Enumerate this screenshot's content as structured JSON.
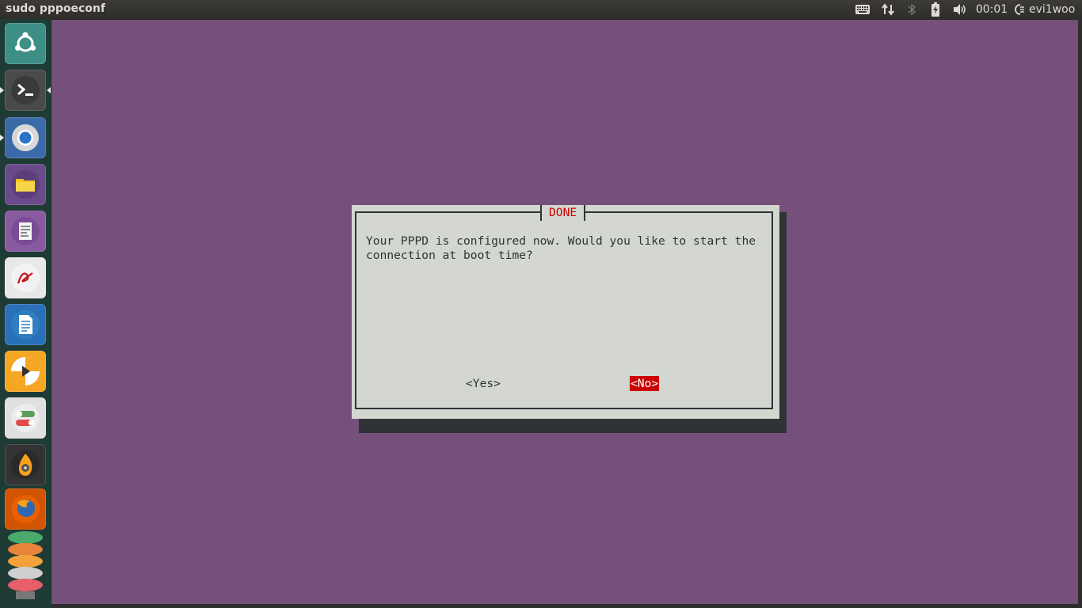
{
  "top_panel": {
    "window_title": "sudo pppoeconf",
    "clock": "00:01",
    "username": "evi1woo",
    "indicators": [
      "keyboard-icon",
      "network-icon",
      "bluetooth-icon",
      "battery-icon",
      "volume-icon",
      "session-icon"
    ]
  },
  "launcher": {
    "items": [
      {
        "name": "ubuntu-dash-icon",
        "color": "#3d8f86"
      },
      {
        "name": "terminal-icon",
        "color": "#4a4a4a"
      },
      {
        "name": "chromium-icon",
        "color": "#3a6aa8"
      },
      {
        "name": "files-icon",
        "color": "#6a4a8a"
      },
      {
        "name": "text-editor-icon",
        "color": "#8a5aa0"
      },
      {
        "name": "document-viewer-icon",
        "color": "#e8e8e8"
      },
      {
        "name": "libreoffice-writer-icon",
        "color": "#2a70b8"
      },
      {
        "name": "media-player-icon",
        "color": "#f5a623"
      },
      {
        "name": "settings-toggle-icon",
        "color": "#e0e0e0"
      },
      {
        "name": "brasero-icon",
        "color": "#333333"
      },
      {
        "name": "firefox-icon",
        "color": "#d35400"
      },
      {
        "name": "stacked-apps-icon",
        "color": "#c0392b"
      }
    ]
  },
  "dialog": {
    "title": "DONE",
    "message": "Your PPPD is configured now. Would you like to start the\nconnection at boot time?",
    "yes_label": "<Yes>",
    "no_label": "<No>",
    "colors": {
      "background": "#d3d7cf",
      "accent": "#cc0000",
      "terminal": "#75507b"
    }
  }
}
